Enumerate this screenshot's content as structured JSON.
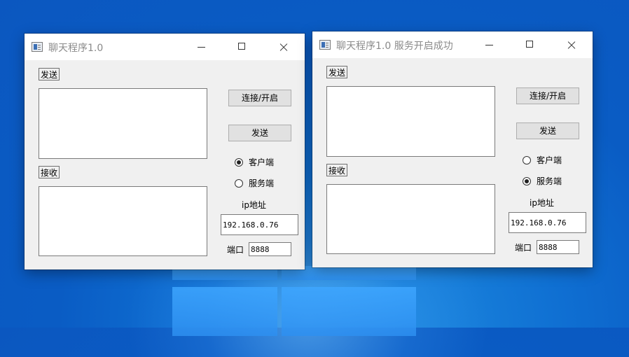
{
  "desktop": {
    "accent": "#0b5fc6"
  },
  "client_window": {
    "title": "聊天程序1.0",
    "send_label": "发送",
    "receive_label": "接收",
    "connect_button": "连接/开启",
    "send_button": "发送",
    "radio_client": "客户端",
    "radio_server": "服务端",
    "selected": "客户端",
    "ip_label": "ip地址",
    "ip_value": "192.168.0.76",
    "port_label": "端口",
    "port_value": "8888"
  },
  "server_window": {
    "title": "聊天程序1.0 服务开启成功",
    "send_label": "发送",
    "receive_label": "接收",
    "connect_button": "连接/开启",
    "send_button": "发送",
    "radio_client": "客户端",
    "radio_server": "服务端",
    "selected": "服务端",
    "ip_label": "ip地址",
    "ip_value": "192.168.0.76",
    "port_label": "端口",
    "port_value": "8888"
  }
}
